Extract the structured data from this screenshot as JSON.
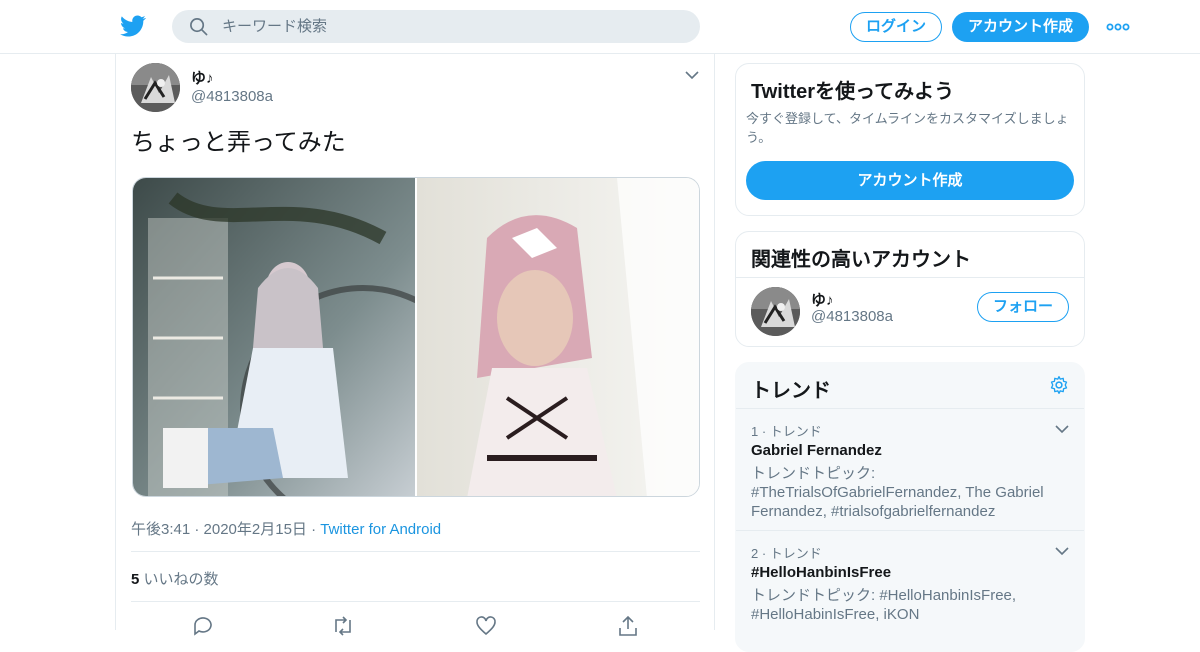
{
  "header": {
    "search_placeholder": "キーワード検索",
    "login_label": "ログイン",
    "signup_label": "アカウント作成"
  },
  "tweet": {
    "author_name": "ゆ♪",
    "author_handle": "@4813808a",
    "text": "ちょっと弄ってみた",
    "time_date": "午後3:41 · 2020年2月15日",
    "dot": "·",
    "source": "Twitter for Android",
    "likes_count": "5",
    "likes_label": "いいねの数"
  },
  "sidebar": {
    "signup_card": {
      "title": "Twitterを使ってみよう",
      "description": "今すぐ登録して、タイムラインをカスタマイズしましょう。",
      "button_label": "アカウント作成"
    },
    "related_card": {
      "title": "関連性の高いアカウント",
      "account_name": "ゆ♪",
      "account_handle": "@4813808a",
      "follow_label": "フォロー"
    },
    "trends_card": {
      "title": "トレンド",
      "items": [
        {
          "rank": "1 · トレンド",
          "name": "Gabriel Fernandez",
          "topic": "トレンドトピック: #TheTrialsOfGabrielFernandez, The Gabriel Fernandez, #trialsofgabrielfernandez"
        },
        {
          "rank": "2 · トレンド",
          "name": "#HelloHanbinIsFree",
          "topic": "トレンドトピック: #HelloHanbinIsFree, #HelloHabinIsFree, iKON"
        }
      ]
    }
  },
  "colors": {
    "brand": "#1da1f2",
    "link": "#1b95e0",
    "muted_text": "#657786",
    "border": "#e6ecf0"
  },
  "icons": [
    "twitter-bird-icon",
    "search-icon",
    "more-dots-icon",
    "chevron-down-icon",
    "gear-icon",
    "reply-icon",
    "retweet-icon",
    "like-icon",
    "share-icon"
  ]
}
